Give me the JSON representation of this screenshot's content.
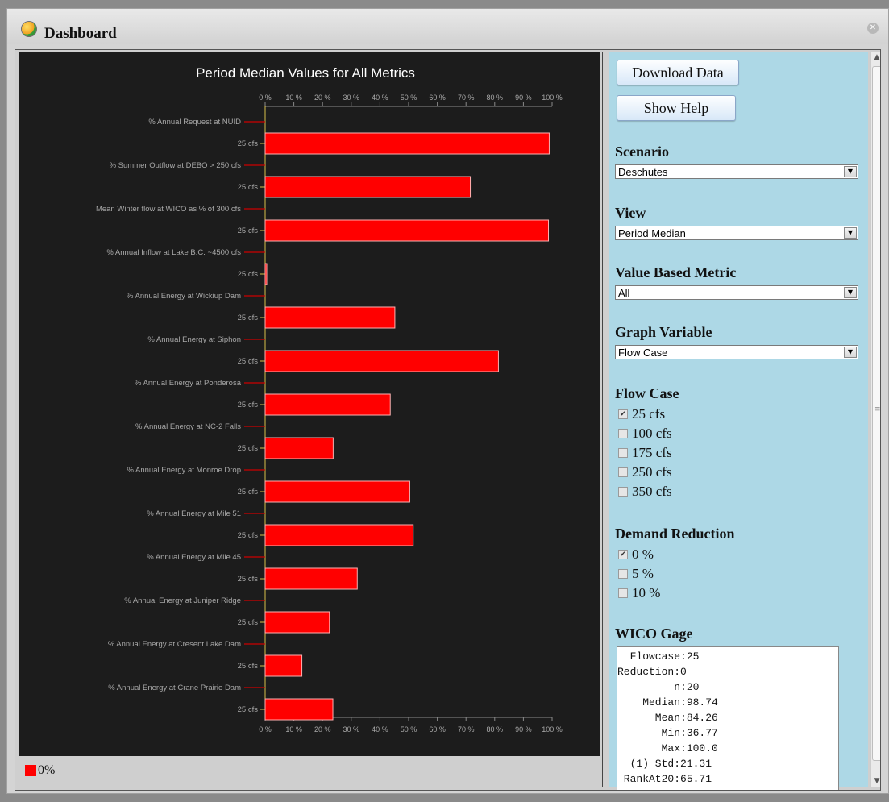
{
  "window": {
    "title": "Dashboard"
  },
  "toolbar": {
    "download_label": "Download Data",
    "help_label": "Show Help"
  },
  "controls": {
    "scenario": {
      "label": "Scenario",
      "value": "Deschutes"
    },
    "view": {
      "label": "View",
      "value": "Period Median"
    },
    "metric": {
      "label": "Value Based Metric",
      "value": "All"
    },
    "graph_variable": {
      "label": "Graph Variable",
      "value": "Flow Case"
    },
    "flow_case": {
      "label": "Flow Case",
      "options": [
        {
          "label": "25 cfs",
          "checked": true
        },
        {
          "label": "100 cfs",
          "checked": false
        },
        {
          "label": "175 cfs",
          "checked": false
        },
        {
          "label": "250 cfs",
          "checked": false
        },
        {
          "label": "350 cfs",
          "checked": false
        }
      ]
    },
    "demand_reduction": {
      "label": "Demand Reduction",
      "options": [
        {
          "label": "0 %",
          "checked": true
        },
        {
          "label": "5 %",
          "checked": false
        },
        {
          "label": "10 %",
          "checked": false
        }
      ]
    }
  },
  "stats": {
    "title": "WICO Gage",
    "lines": [
      "  Flowcase:25",
      "Reduction:0",
      "         n:20",
      "    Median:98.74",
      "      Mean:84.26",
      "       Min:36.77",
      "       Max:100.0",
      "  (1) Std:21.31",
      " RankAt20:65.71"
    ]
  },
  "legend": {
    "label": "0%",
    "color": "#ff0000"
  },
  "chart_data": {
    "type": "bar",
    "orientation": "horizontal",
    "title": "Period Median Values  for All Metrics",
    "xlim": [
      0,
      100
    ],
    "x_ticks": [
      "0 %",
      "10 %",
      "20 %",
      "30 %",
      "40 %",
      "50 %",
      "60 %",
      "70 %",
      "80 %",
      "90 %",
      "100 %"
    ],
    "bar_color": "#ff0000",
    "series": [
      {
        "name": "0%",
        "color": "#ff0000"
      }
    ],
    "groups": [
      {
        "metric": "% Annual Request at NUID",
        "category": "25 cfs",
        "value": 99.0
      },
      {
        "metric": "% Summer Outflow at DEBO > 250 cfs",
        "category": "25 cfs",
        "value": 71.5
      },
      {
        "metric": "Mean Winter flow at WICO as % of 300 cfs",
        "category": "25 cfs",
        "value": 98.74
      },
      {
        "metric": "% Annual Inflow at Lake B.C. ~4500 cfs",
        "category": "25 cfs",
        "value": 0.5
      },
      {
        "metric": "% Annual Energy at Wickiup Dam",
        "category": "25 cfs",
        "value": 45.2
      },
      {
        "metric": "% Annual Energy at Siphon",
        "category": "25 cfs",
        "value": 81.3
      },
      {
        "metric": "% Annual Energy at Ponderosa",
        "category": "25 cfs",
        "value": 43.6
      },
      {
        "metric": "% Annual Energy at NC-2 Falls",
        "category": "25 cfs",
        "value": 23.7
      },
      {
        "metric": "% Annual Energy at Monroe Drop",
        "category": "25 cfs",
        "value": 50.4
      },
      {
        "metric": "% Annual Energy at Mile 51",
        "category": "25 cfs",
        "value": 51.6
      },
      {
        "metric": "% Annual Energy at Mile 45",
        "category": "25 cfs",
        "value": 32.1
      },
      {
        "metric": "% Annual Energy at Juniper Ridge",
        "category": "25 cfs",
        "value": 22.4
      },
      {
        "metric": "% Annual Energy at Cresent Lake Dam",
        "category": "25 cfs",
        "value": 12.8
      },
      {
        "metric": "% Annual Energy at Crane Prairie Dam",
        "category": "25 cfs",
        "value": 23.6
      }
    ]
  }
}
